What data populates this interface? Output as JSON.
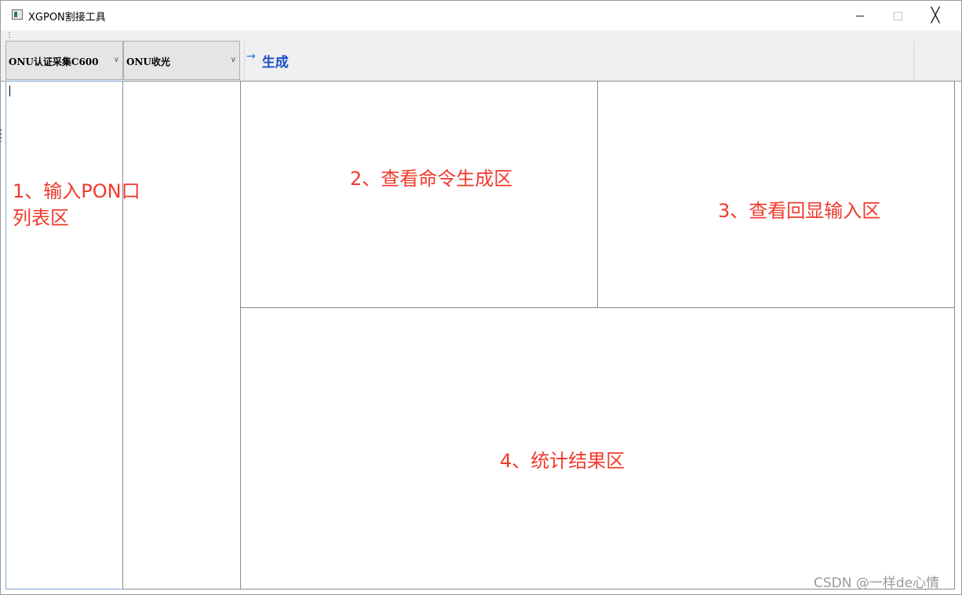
{
  "window": {
    "title": "XGPON割接工具",
    "minimize_icon": "minimize-icon",
    "maximize_icon": "maximize-icon",
    "close_icon": "close-icon",
    "close_glyph": "╳"
  },
  "toolbar": {
    "combo1_value": "ONU认证采集C600",
    "combo2_value": "ONU收光",
    "generate_label": "生成",
    "generate_icon": "arrow-right-icon",
    "generate_arrow": "→",
    "chevron": "∨"
  },
  "annotations": {
    "area1_line1": "1、输入PON口",
    "area1_line2": "列表区",
    "area2": "2、查看命令生成区",
    "area3": "3、查看回显输入区",
    "area4": "4、统计结果区"
  },
  "watermark": "CSDN @一样de心情",
  "colors": {
    "annotation": "#f0392b",
    "generate_text": "#1a4fc8",
    "focus_border": "#7aa7d8"
  }
}
